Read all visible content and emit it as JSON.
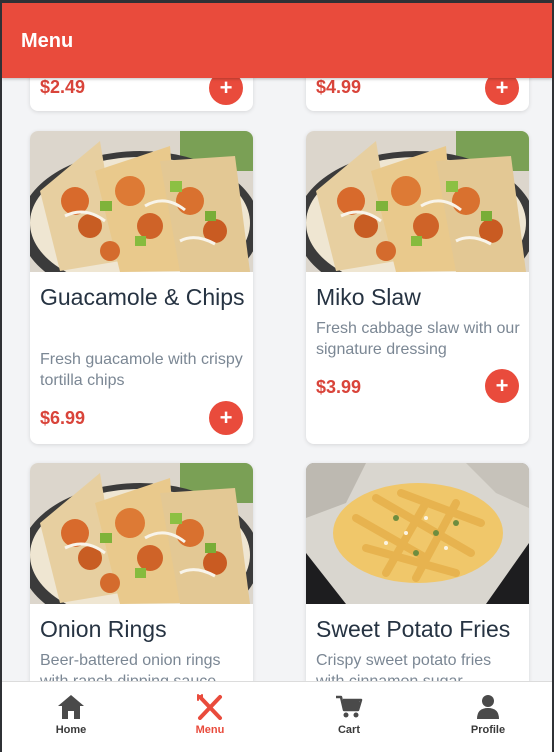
{
  "header": {
    "title": "Menu"
  },
  "top_cards": [
    {
      "price": "$2.49"
    },
    {
      "price": "$4.99"
    }
  ],
  "cards": [
    {
      "name": "Guacamole & Chips",
      "description": "Fresh guacamole with crispy tortilla chips",
      "price": "$6.99",
      "image": "tacos-photo"
    },
    {
      "name": "Miko Slaw",
      "description": "Fresh cabbage slaw with our signature dressing",
      "price": "$3.99",
      "image": "tacos-photo"
    },
    {
      "name": "Onion Rings",
      "description": "Beer-battered onion rings with ranch dipping sauce",
      "image": "tacos-photo"
    },
    {
      "name": "Sweet Potato Fries",
      "description": "Crispy sweet potato fries with cinnamon sugar",
      "image": "fries-photo"
    }
  ],
  "add_label": "+",
  "nav": [
    {
      "label": "Home",
      "icon": "home-icon"
    },
    {
      "label": "Menu",
      "icon": "fork-knife-icon",
      "active": true
    },
    {
      "label": "Cart",
      "icon": "cart-icon"
    },
    {
      "label": "Profile",
      "icon": "person-icon"
    }
  ],
  "colors": {
    "accent": "#e94b3c",
    "title": "#263342",
    "muted": "#7b8794"
  }
}
